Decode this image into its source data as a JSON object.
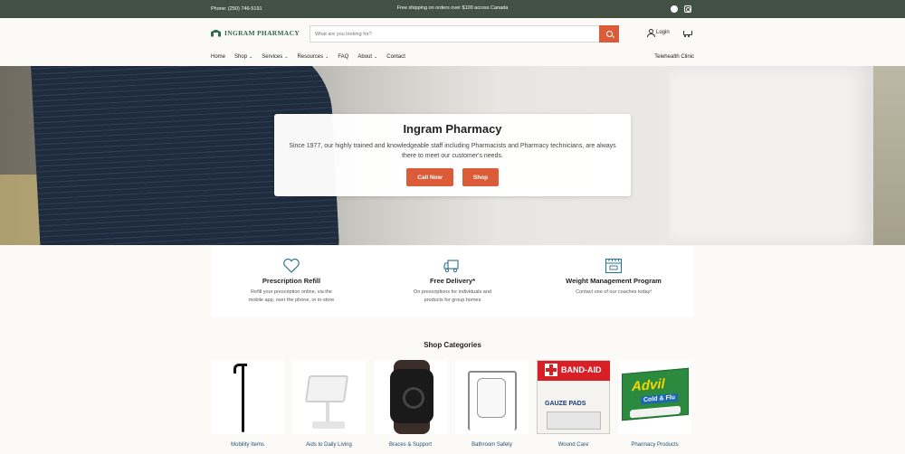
{
  "topbar": {
    "phone": "Phone: (250) 746-5191",
    "shipping": "Free shipping on orders over $100 across Canada",
    "social": [
      "facebook-icon",
      "instagram-icon"
    ]
  },
  "header": {
    "logo_text": "INGRAM PHARMACY",
    "search_placeholder": "What are you looking for?",
    "login_label": "Login"
  },
  "nav": {
    "items": [
      {
        "label": "Home",
        "dropdown": false
      },
      {
        "label": "Shop",
        "dropdown": true
      },
      {
        "label": "Services",
        "dropdown": true
      },
      {
        "label": "Resources",
        "dropdown": true
      },
      {
        "label": "FAQ",
        "dropdown": false
      },
      {
        "label": "About",
        "dropdown": true
      },
      {
        "label": "Contact",
        "dropdown": false
      }
    ],
    "right_link": "Telehealth Clinic",
    "chevron": "⌄"
  },
  "hero": {
    "title": "Ingram Pharmacy",
    "text": "Since 1977, our highly trained and knowledgeable staff including Pharmacists and Pharmacy technicians, are always there to meet our customer's needs.",
    "call_label": "Call Now",
    "shop_label": "Shop"
  },
  "features": [
    {
      "icon": "heart-icon",
      "title": "Prescription Refill",
      "text": "Refill your prescription online, via the mobile app, over the phone, or in-store"
    },
    {
      "icon": "truck-icon",
      "title": "Free Delivery*",
      "text": "On prescriptions for individuals and products for group homes"
    },
    {
      "icon": "scale-icon",
      "title": "Weight Management Program",
      "text": "Contact one of our coaches today!"
    }
  ],
  "categories": {
    "title": "Shop Categories",
    "items": [
      {
        "label": "Mobility Items"
      },
      {
        "label": "Aids to Daily Living"
      },
      {
        "label": "Braces & Support"
      },
      {
        "label": "Bathroom Safety"
      },
      {
        "label": "Wound Care",
        "brand": "BAND-AID",
        "pack_text": "GAUZE PADS"
      },
      {
        "label": "Pharmacy Products",
        "brand": "Advil",
        "pack_text": "Cold & Flu"
      }
    ]
  },
  "colors": {
    "topbar": "#425143",
    "accent": "#dc5b38",
    "brand_green": "#2e6b4a",
    "link": "#1f4f78"
  }
}
